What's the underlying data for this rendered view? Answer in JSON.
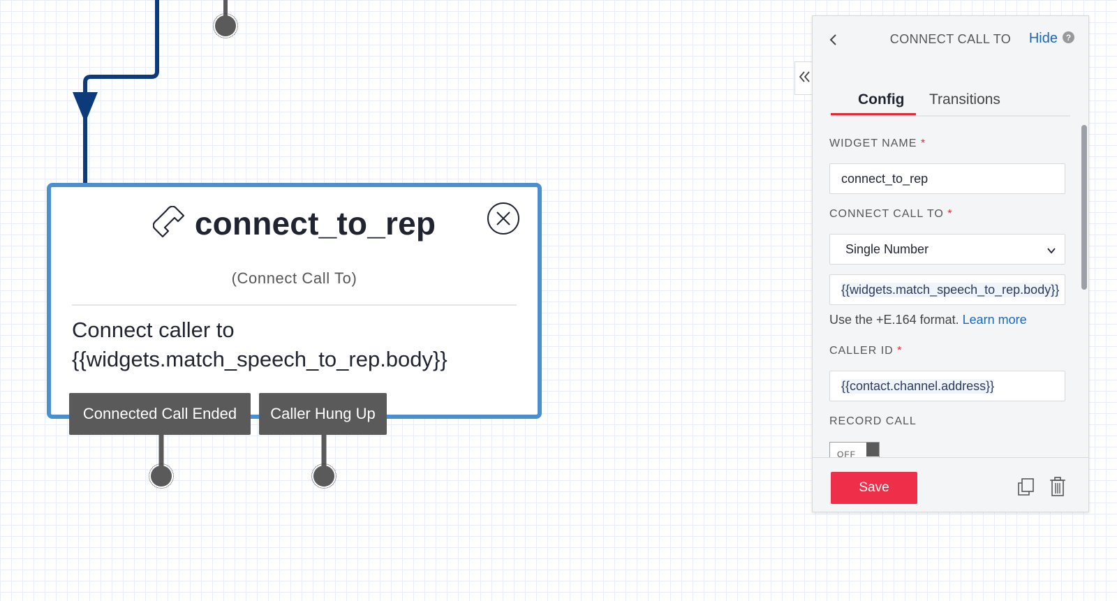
{
  "widget": {
    "title": "connect_to_rep",
    "type": "(Connect Call To)",
    "body": "Connect caller to {{widgets.match_speech_to_rep.body}}",
    "transitions": [
      "Connected Call Ended",
      "Caller Hung Up"
    ]
  },
  "panel": {
    "title": "CONNECT CALL TO",
    "hide_label": "Hide",
    "help_glyph": "?",
    "tabs": [
      {
        "label": "Config",
        "active": true
      },
      {
        "label": "Transitions",
        "active": false
      }
    ],
    "fields": {
      "widget_name": {
        "label": "WIDGET NAME",
        "required_mark": "*",
        "value": "connect_to_rep"
      },
      "connect_call_to": {
        "label": "CONNECT CALL TO",
        "required_mark": "*",
        "selected": "Single Number",
        "number_value": "{{widgets.match_speech_to_rep.body}}",
        "hint_text": "Use the +E.164 format.",
        "hint_link": "Learn more"
      },
      "caller_id": {
        "label": "CALLER ID",
        "required_mark": "*",
        "value": "{{contact.channel.address}}"
      },
      "record_call": {
        "label": "RECORD CALL",
        "toggle_label": "OFF",
        "state": false
      }
    },
    "save_label": "Save"
  },
  "colors": {
    "widget_border": "#4a90d0",
    "connector_line": "#0d3a7a",
    "save_button": "#ef2f49",
    "active_tab_underline": "#e12b3a",
    "link": "#1a66b8"
  },
  "icons": [
    "phone-icon",
    "close-circle-icon",
    "chevron-left-icon",
    "help-icon",
    "double-chevron-left-icon",
    "chevron-down-icon",
    "duplicate-icon",
    "trash-icon"
  ]
}
